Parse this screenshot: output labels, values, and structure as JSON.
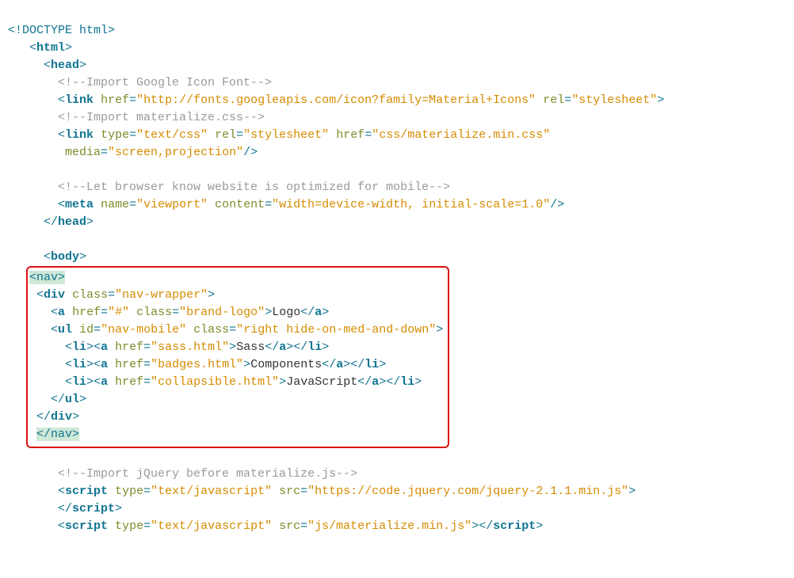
{
  "code": {
    "doctype": "<!DOCTYPE html>",
    "htmlOpen": "html",
    "headOpen": "head",
    "cmt1": "<!--Import Google Icon Font-->",
    "link1_href": "\"http://fonts.googleapis.com/icon?family=Material+Icons\"",
    "link1_rel": "\"stylesheet\"",
    "cmt2": "<!--Import materialize.css-->",
    "link2_type": "\"text/css\"",
    "link2_rel": "\"stylesheet\"",
    "link2_href": "\"css/materialize.min.css\"",
    "link2_media": "\"screen,projection\"",
    "cmt3": "<!--Let browser know website is optimized for mobile-->",
    "meta_name": "\"viewport\"",
    "meta_content": "\"width=device-width, initial-scale=1.0\"",
    "headClose": "head",
    "bodyOpen": "body",
    "navOpen": "<nav>",
    "div_attr": "class",
    "div_val": "\"nav-wrapper\"",
    "a1_href": "\"#\"",
    "a1_class": "\"brand-logo\"",
    "a1_txt": "Logo",
    "ul_id": "\"nav-mobile\"",
    "ul_class": "\"right hide-on-med-and-down\"",
    "li1_href": "\"sass.html\"",
    "li1_txt": "Sass",
    "li2_href": "\"badges.html\"",
    "li2_txt": "Components",
    "li3_href": "\"collapsible.html\"",
    "li3_txt": "JavaScript",
    "navClose": "</nav>",
    "cmt4": "<!--Import jQuery before materialize.js-->",
    "s1_type": "\"text/javascript\"",
    "s1_src": "\"https://code.jquery.com/jquery-2.1.1.min.js\"",
    "s2_type": "\"text/javascript\"",
    "s2_src": "\"js/materialize.min.js\""
  }
}
